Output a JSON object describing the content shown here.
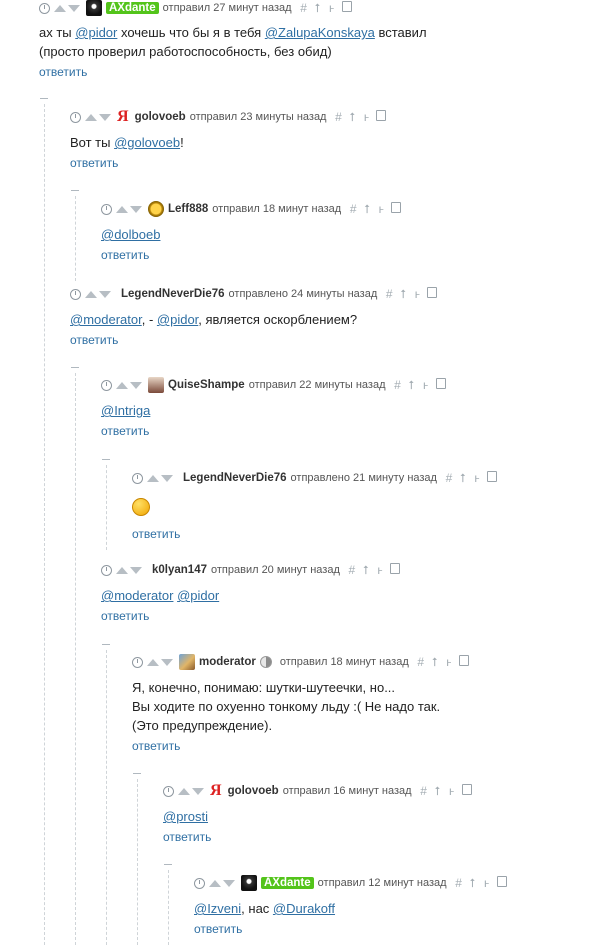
{
  "comments": [
    {
      "id": "c1",
      "author": "AXdante",
      "sent": "отправил 27 минут назад",
      "line1": "ах ты  ",
      "m1": "@pidor",
      "line1b": " хочешь что бы я в тебя ",
      "m2": "@ZalupaKonskaya",
      "line1c": " вставил",
      "line2": "(просто проверил работоспособность, без обид)",
      "reply": "ответить"
    },
    {
      "id": "c2",
      "author": "golovoeb",
      "sent": "отправил 23 минуты назад",
      "text_pre": "Вот ты ",
      "m1": "@golovoeb",
      "text_post": "!",
      "reply": "ответить"
    },
    {
      "id": "c3",
      "author": "Leff888",
      "sent": "отправил 18 минут назад",
      "m1": "@dolboeb",
      "reply": "ответить"
    },
    {
      "id": "c4",
      "author": "LegendNeverDie76",
      "sent": "отправлено 24 минуты назад",
      "m1": "@moderator",
      "mid": ", - ",
      "m2": "@pidor",
      "post": ", является оскорблением?",
      "reply": "ответить"
    },
    {
      "id": "c5",
      "author": "QuiseShampe",
      "sent": "отправил 22 минуты назад",
      "m1": "@Intriga",
      "reply": "ответить"
    },
    {
      "id": "c6",
      "author": "LegendNeverDie76",
      "sent": "отправлено 21 минуту назад",
      "reply": "ответить"
    },
    {
      "id": "c7",
      "author": "k0lyan147",
      "sent": "отправил 20 минут назад",
      "m1": "@moderator",
      "m2": "@pidor",
      "reply": "ответить"
    },
    {
      "id": "c8",
      "author": "moderator",
      "sent": "отправил 18 минут назад",
      "l1": "Я, конечно, понимаю: шутки-шутеечки, но...",
      "l2": "Вы ходите по охуенно тонкому льду :( Не надо так.",
      "l3": "(Это предупреждение).",
      "reply": "ответить"
    },
    {
      "id": "c9",
      "author": "golovoeb",
      "sent": "отправил 16 минут назад",
      "m1": "@prosti",
      "reply": "ответить"
    },
    {
      "id": "c10",
      "author": "AXdante",
      "sent": "отправил 12 минут назад",
      "m1": "@Izveni",
      "mid": ", нас ",
      "m2": "@Durakoff",
      "reply": "ответить"
    }
  ],
  "icons": {
    "hash": "#",
    "up": "⭡",
    "branch": "ⱶ"
  }
}
